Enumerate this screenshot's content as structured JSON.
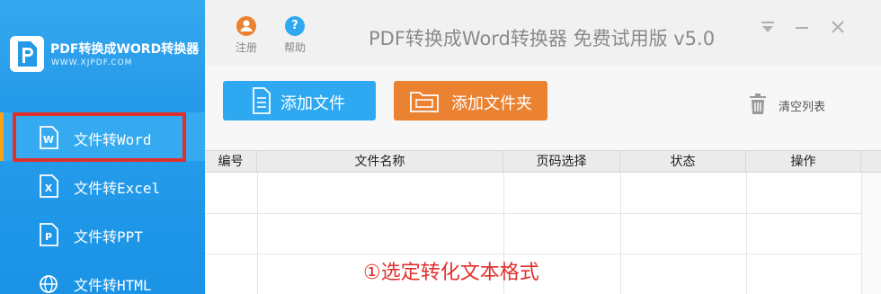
{
  "sidebar": {
    "logo_title": "PDF转换成WORD转换器",
    "logo_url": "WWW.XJPDF.COM",
    "items": [
      {
        "label": "文件转Word",
        "icon": "word-doc-icon"
      },
      {
        "label": "文件转Excel",
        "icon": "excel-doc-icon"
      },
      {
        "label": "文件转PPT",
        "icon": "ppt-doc-icon"
      },
      {
        "label": "文件转HTML",
        "icon": "globe-icon"
      }
    ]
  },
  "titlebar": {
    "register_label": "注册",
    "help_label": "帮助",
    "title": "PDF转换成Word转换器 免费试用版 v5.0"
  },
  "toolbar": {
    "add_file_label": "添加文件",
    "add_folder_label": "添加文件夹",
    "clear_list_label": "清空列表"
  },
  "table": {
    "columns": [
      "编号",
      "文件名称",
      "页码选择",
      "状态",
      "操作"
    ]
  },
  "annotation": "①选定转化文本格式",
  "colors": {
    "sidebar": "#1a93e6",
    "add_file_button": "#2ea8f0",
    "add_folder_button": "#eb8231",
    "highlight": "#e0302c"
  }
}
